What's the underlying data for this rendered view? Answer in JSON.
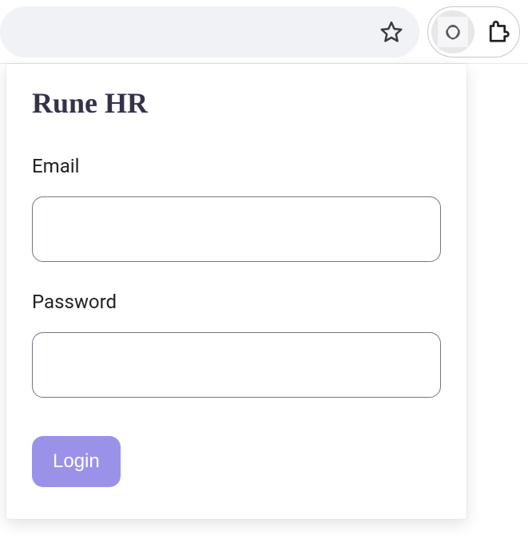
{
  "browser": {
    "star_icon": "star-icon",
    "extension_icon": "redux-devtools-icon",
    "extensions_menu_icon": "extensions-puzzle-icon"
  },
  "login": {
    "title": "Rune HR",
    "email_label": "Email",
    "email_value": "",
    "password_label": "Password",
    "password_value": "",
    "submit_label": "Login"
  }
}
